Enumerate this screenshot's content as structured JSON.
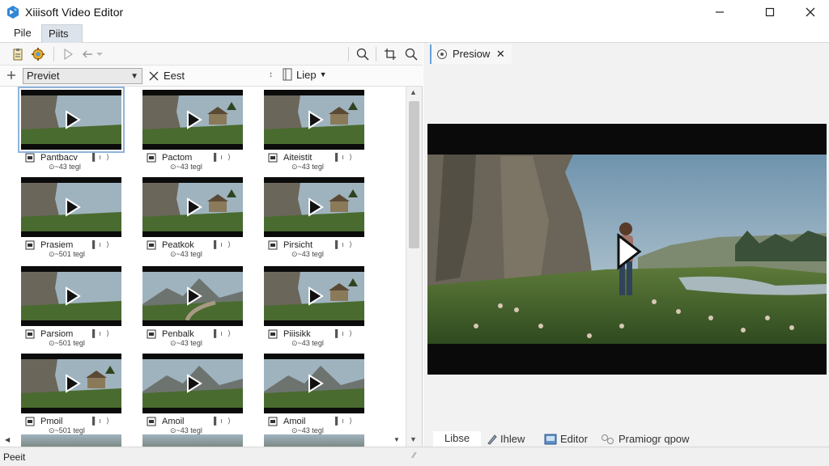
{
  "window": {
    "title": "Xiiisoft Video Editor"
  },
  "menu": {
    "items": [
      "Pile",
      "Piits"
    ]
  },
  "filter": {
    "combo_value": "Previet",
    "clear_label": "Eest",
    "view_label": "Liep"
  },
  "thumbnails": [
    {
      "name": "Pantbacv",
      "meta": "⊙~43 tegl",
      "dots": "▌ı ⟩"
    },
    {
      "name": "Pactom",
      "meta": "⊙~43 tegl",
      "dots": "▌ı ⟩"
    },
    {
      "name": "Aiteistit",
      "meta": "⊙~43 tegl",
      "dots": "▌ı ⟩"
    },
    {
      "name": "Prasiem",
      "meta": "⊙~501 tegl",
      "dots": "▌ı ⟩"
    },
    {
      "name": "Peatkok",
      "meta": "⊙~43 tegl",
      "dots": "▌ı ⟩"
    },
    {
      "name": "Pirsicht",
      "meta": "⊙~43 tegl",
      "dots": "▌ı ⟩"
    },
    {
      "name": "Parsiom",
      "meta": "⊙~501 tegl",
      "dots": "▌ı ⟩"
    },
    {
      "name": "Penbalk",
      "meta": "⊙~43 tegl",
      "dots": "▌ı ⟩"
    },
    {
      "name": "Piiisikk",
      "meta": "⊙~43 tegl",
      "dots": "▌ı ⟩"
    },
    {
      "name": "Pmoil",
      "meta": "⊙~501 tegl",
      "dots": "▌ı ⟩"
    },
    {
      "name": "Amoil",
      "meta": "⊙~43 tegl",
      "dots": "▌ı ⟩"
    },
    {
      "name": "Amoil",
      "meta": "⊙~43 tegl",
      "dots": "▌ı ⟩"
    }
  ],
  "preview": {
    "tab_label": "Presiow",
    "close": "✕"
  },
  "bottom_tabs": [
    "Libse",
    "Ihlew",
    "Editor",
    "Pramiogr qpow"
  ],
  "status": {
    "text": "Peeit"
  },
  "colors": {
    "accent": "#3b82c4",
    "selection": "#8fb4dc",
    "menu_active": "#dde3ea"
  }
}
